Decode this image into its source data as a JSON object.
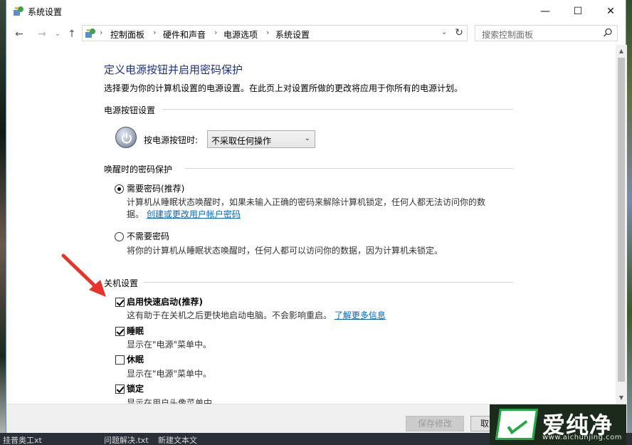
{
  "window": {
    "title": "系统设置",
    "minimize": "—",
    "maximize": "☐",
    "close": "✕"
  },
  "nav": {
    "back": "←",
    "forward": "→",
    "recent": "⌄",
    "up": "↑",
    "breadcrumb": [
      "控制面板",
      "硬件和声音",
      "电源选项",
      "系统设置"
    ],
    "sep": "›",
    "dropdown": "⌄",
    "refresh": "↻"
  },
  "search": {
    "placeholder": "搜索控制面板"
  },
  "page": {
    "heading": "定义电源按钮并启用密码保护",
    "description": "选择要为你的计算机设置的电源设置。在此页上对设置所做的更改将应用于你所有的电源计划。"
  },
  "power_section": {
    "title": "电源按钮设置",
    "button_label": "按电源按钮时:",
    "select_value": "不采取任何操作",
    "select_arrow": "⌄"
  },
  "password_section": {
    "title": "唤醒时的密码保护",
    "require": {
      "label": "需要密码(推荐)",
      "desc_line1": "计算机从睡眠状态唤醒时，如果未输入正确的密码来解除计算机锁定，任何人都无法访问你的数",
      "desc_line2": "据。",
      "link": "创建或更改用户帐户密码",
      "selected": true
    },
    "not_require": {
      "label": "不需要密码",
      "desc": "将你的计算机从睡眠状态唤醒时，任何人都可以访问你的数据，因为计算机未锁定。",
      "selected": false
    }
  },
  "shutdown_section": {
    "title": "关机设置",
    "fast_startup": {
      "label": "启用快速启动(推荐)",
      "desc": "这有助于在关机之后更快地启动电脑。不会影响重启。",
      "link": "了解更多信息",
      "checked": true
    },
    "sleep": {
      "label": "睡眠",
      "desc": "显示在\"电源\"菜单中。",
      "checked": true
    },
    "hibernate": {
      "label": "休眠",
      "desc": "显示在\"电源\"菜单中。",
      "checked": false
    },
    "lock": {
      "label": "锁定",
      "desc": "显示在用户头像菜单中。",
      "checked": true
    }
  },
  "footer": {
    "save": "保存修改",
    "cancel": "取"
  },
  "taskbar": {
    "item1": "挂普奥工xt",
    "item2": "问题解决.txt",
    "item3": "新建文本文"
  },
  "watermark": {
    "brand": "爱纯净",
    "url": "www.aichunjing.com"
  },
  "colors": {
    "heading": "#1e3287",
    "link": "#0066cc",
    "arrow": "#e8332a",
    "brand_green": "#22a845"
  }
}
